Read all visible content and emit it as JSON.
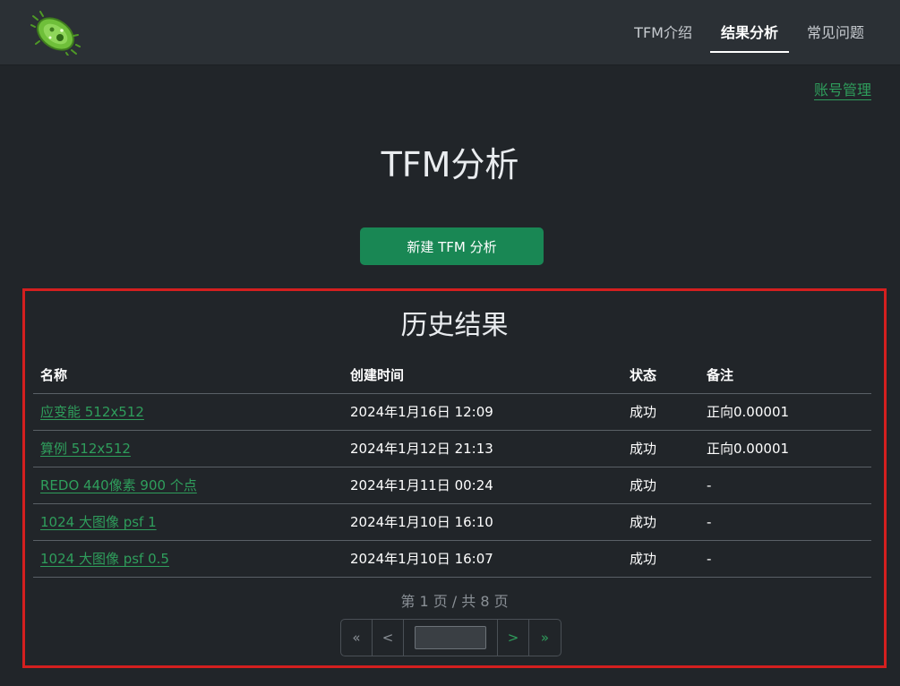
{
  "nav": {
    "logo_icon": "microbe-icon",
    "items": [
      {
        "label": "TFM介绍",
        "active": false
      },
      {
        "label": "结果分析",
        "active": true
      },
      {
        "label": "常见问题",
        "active": false
      }
    ]
  },
  "account_link": "账号管理",
  "page_title": "TFM分析",
  "new_button": "新建 TFM 分析",
  "history": {
    "title": "历史结果",
    "columns": [
      "名称",
      "创建时间",
      "状态",
      "备注"
    ],
    "rows": [
      {
        "name": "应变能 512x512",
        "time": "2024年1月16日 12:09",
        "status": "成功",
        "note": "正向0.00001"
      },
      {
        "name": "算例 512x512",
        "time": "2024年1月12日 21:13",
        "status": "成功",
        "note": "正向0.00001"
      },
      {
        "name": "REDO 440像素 900 个点",
        "time": "2024年1月11日 00:24",
        "status": "成功",
        "note": "-"
      },
      {
        "name": "1024 大图像 psf 1",
        "time": "2024年1月10日 16:10",
        "status": "成功",
        "note": "-"
      },
      {
        "name": "1024 大图像 psf 0.5",
        "time": "2024年1月10日 16:07",
        "status": "成功",
        "note": "-"
      }
    ],
    "page_info": "第 1 页 / 共 8 页",
    "pager": {
      "first": "«",
      "prev": "<",
      "page_value": "",
      "next": ">",
      "last": "»"
    }
  },
  "colors": {
    "background": "#212529",
    "navbar": "#2b3035",
    "accent_green": "#198754",
    "link_green": "#2f9e5c",
    "highlight_border": "#d41f1f"
  }
}
